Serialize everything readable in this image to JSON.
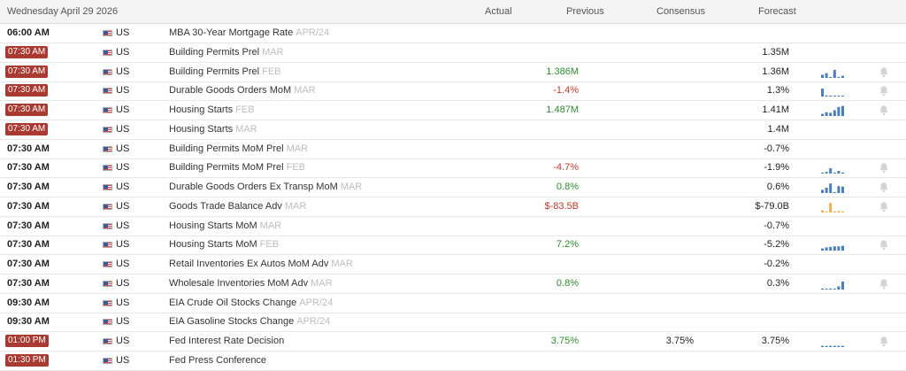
{
  "header": {
    "date": "Wednesday April 29 2026",
    "col_actual": "Actual",
    "col_previous": "Previous",
    "col_consensus": "Consensus",
    "col_forecast": "Forecast"
  },
  "colors": {
    "time_badge": "#a83a32",
    "positive": "#2e8b2e",
    "negative": "#c0392b",
    "spark_blue": "#4a7fbf",
    "spark_orange": "#f0b050"
  },
  "rows": [
    {
      "time": "06:00 AM",
      "badge": false,
      "country": "US",
      "event": "MBA 30-Year Mortgage Rate",
      "period": "APR/24",
      "actual": "",
      "previous": "",
      "previous_tone": "neu",
      "consensus": "",
      "forecast": "",
      "spark": [],
      "spark_color": "",
      "bell": false
    },
    {
      "time": "07:30 AM",
      "badge": true,
      "country": "US",
      "event": "Building Permits Prel",
      "period": "MAR",
      "actual": "",
      "previous": "",
      "previous_tone": "neu",
      "consensus": "",
      "forecast": "1.35M",
      "spark": [],
      "spark_color": "",
      "bell": false
    },
    {
      "time": "07:30 AM",
      "badge": true,
      "country": "US",
      "event": "Building Permits Prel",
      "period": "FEB",
      "actual": "",
      "previous": "1.386M",
      "previous_tone": "pos",
      "consensus": "",
      "forecast": "1.36M",
      "spark": [
        0.3,
        0.45,
        0.0,
        0.75,
        0.0,
        0.2
      ],
      "spark_color": "#4a7fbf",
      "bell": true
    },
    {
      "time": "07:30 AM",
      "badge": true,
      "country": "US",
      "event": "Durable Goods Orders MoM",
      "period": "MAR",
      "actual": "",
      "previous": "-1.4%",
      "previous_tone": "neg",
      "consensus": "",
      "forecast": "1.3%",
      "spark": [
        0.75,
        0.1,
        0.0,
        0.05,
        0.0,
        0.05
      ],
      "spark_color": "#4a7fbf",
      "bell": true
    },
    {
      "time": "07:30 AM",
      "badge": true,
      "country": "US",
      "event": "Housing Starts",
      "period": "FEB",
      "actual": "",
      "previous": "1.487M",
      "previous_tone": "pos",
      "consensus": "",
      "forecast": "1.41M",
      "spark": [
        0.2,
        0.35,
        0.3,
        0.55,
        0.85,
        0.95
      ],
      "spark_color": "#4a7fbf",
      "bell": true
    },
    {
      "time": "07:30 AM",
      "badge": true,
      "country": "US",
      "event": "Housing Starts",
      "period": "MAR",
      "actual": "",
      "previous": "",
      "previous_tone": "neu",
      "consensus": "",
      "forecast": "1.4M",
      "spark": [],
      "spark_color": "",
      "bell": false
    },
    {
      "time": "07:30 AM",
      "badge": false,
      "country": "US",
      "event": "Building Permits MoM Prel",
      "period": "MAR",
      "actual": "",
      "previous": "",
      "previous_tone": "neu",
      "consensus": "",
      "forecast": "-0.7%",
      "spark": [],
      "spark_color": "",
      "bell": false
    },
    {
      "time": "07:30 AM",
      "badge": false,
      "country": "US",
      "event": "Building Permits MoM Prel",
      "period": "FEB",
      "actual": "",
      "previous": "-4.7%",
      "previous_tone": "neg",
      "consensus": "",
      "forecast": "-1.9%",
      "spark": [
        0.05,
        0.15,
        0.5,
        0.05,
        0.25,
        0.1
      ],
      "spark_color": "#4a7fbf",
      "bell": true
    },
    {
      "time": "07:30 AM",
      "badge": false,
      "country": "US",
      "event": "Durable Goods Orders Ex Transp MoM",
      "period": "MAR",
      "actual": "",
      "previous": "0.8%",
      "previous_tone": "pos",
      "consensus": "",
      "forecast": "0.6%",
      "spark": [
        0.3,
        0.5,
        0.9,
        0.05,
        0.65,
        0.6
      ],
      "spark_color": "#4a7fbf",
      "bell": true
    },
    {
      "time": "07:30 AM",
      "badge": false,
      "country": "US",
      "event": "Goods Trade Balance Adv",
      "period": "MAR",
      "actual": "",
      "previous": "$-83.5B",
      "previous_tone": "neg",
      "consensus": "",
      "forecast": "$-79.0B",
      "spark": [
        0.2,
        0.1,
        0.9,
        0.1,
        0.15,
        0.1
      ],
      "spark_color": "#f0b050",
      "bell": true
    },
    {
      "time": "07:30 AM",
      "badge": false,
      "country": "US",
      "event": "Housing Starts MoM",
      "period": "MAR",
      "actual": "",
      "previous": "",
      "previous_tone": "neu",
      "consensus": "",
      "forecast": "-0.7%",
      "spark": [],
      "spark_color": "",
      "bell": false
    },
    {
      "time": "07:30 AM",
      "badge": false,
      "country": "US",
      "event": "Housing Starts MoM",
      "period": "FEB",
      "actual": "",
      "previous": "7.2%",
      "previous_tone": "pos",
      "consensus": "",
      "forecast": "-5.2%",
      "spark": [
        0.2,
        0.3,
        0.35,
        0.4,
        0.4,
        0.45
      ],
      "spark_color": "#4a7fbf",
      "bell": true
    },
    {
      "time": "07:30 AM",
      "badge": false,
      "country": "US",
      "event": "Retail Inventories Ex Autos MoM Adv",
      "period": "MAR",
      "actual": "",
      "previous": "",
      "previous_tone": "neu",
      "consensus": "",
      "forecast": "-0.2%",
      "spark": [],
      "spark_color": "",
      "bell": false
    },
    {
      "time": "07:30 AM",
      "badge": false,
      "country": "US",
      "event": "Wholesale Inventories MoM Adv",
      "period": "MAR",
      "actual": "",
      "previous": "0.8%",
      "previous_tone": "pos",
      "consensus": "",
      "forecast": "0.3%",
      "spark": [
        0.1,
        0.0,
        0.1,
        0.0,
        0.3,
        0.75
      ],
      "spark_color": "#4a7fbf",
      "bell": true
    },
    {
      "time": "09:30 AM",
      "badge": false,
      "country": "US",
      "event": "EIA Crude Oil Stocks Change",
      "period": "APR/24",
      "actual": "",
      "previous": "",
      "previous_tone": "neu",
      "consensus": "",
      "forecast": "",
      "spark": [],
      "spark_color": "",
      "bell": false
    },
    {
      "time": "09:30 AM",
      "badge": false,
      "country": "US",
      "event": "EIA Gasoline Stocks Change",
      "period": "APR/24",
      "actual": "",
      "previous": "",
      "previous_tone": "neu",
      "consensus": "",
      "forecast": "",
      "spark": [],
      "spark_color": "",
      "bell": false
    },
    {
      "time": "01:00 PM",
      "badge": true,
      "country": "US",
      "event": "Fed Interest Rate Decision",
      "period": "",
      "actual": "",
      "previous": "3.75%",
      "previous_tone": "pos",
      "consensus": "3.75%",
      "forecast": "3.75%",
      "spark": [
        0.12,
        0.12,
        0.12,
        0.12,
        0.12,
        0.12
      ],
      "spark_color": "#4a7fbf",
      "bell": true
    },
    {
      "time": "01:30 PM",
      "badge": true,
      "country": "US",
      "event": "Fed Press Conference",
      "period": "",
      "actual": "",
      "previous": "",
      "previous_tone": "neu",
      "consensus": "",
      "forecast": "",
      "spark": [],
      "spark_color": "",
      "bell": false
    }
  ]
}
